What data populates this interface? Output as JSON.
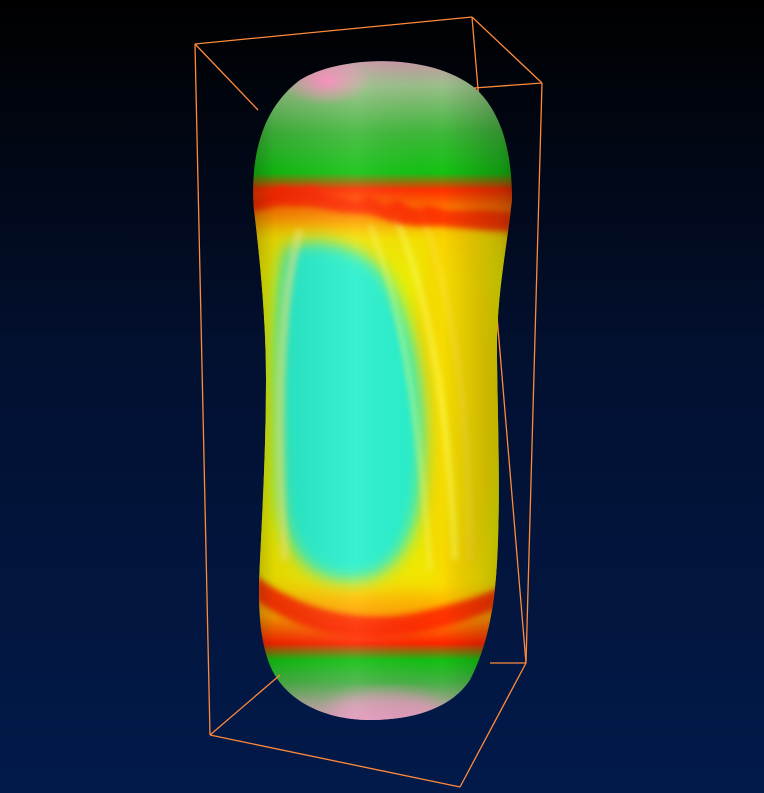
{
  "scene": {
    "kind": "3d-rendering",
    "object": "capsule-shaped-surface",
    "colormap": [
      "#ff8fc0",
      "#00c800",
      "#ff2a00",
      "#ffd000",
      "#f6ff00",
      "#1ef0d2"
    ],
    "bounding_box_color": "#ff8a3a",
    "background_gradient": [
      "#000000",
      "#021a4a"
    ]
  }
}
